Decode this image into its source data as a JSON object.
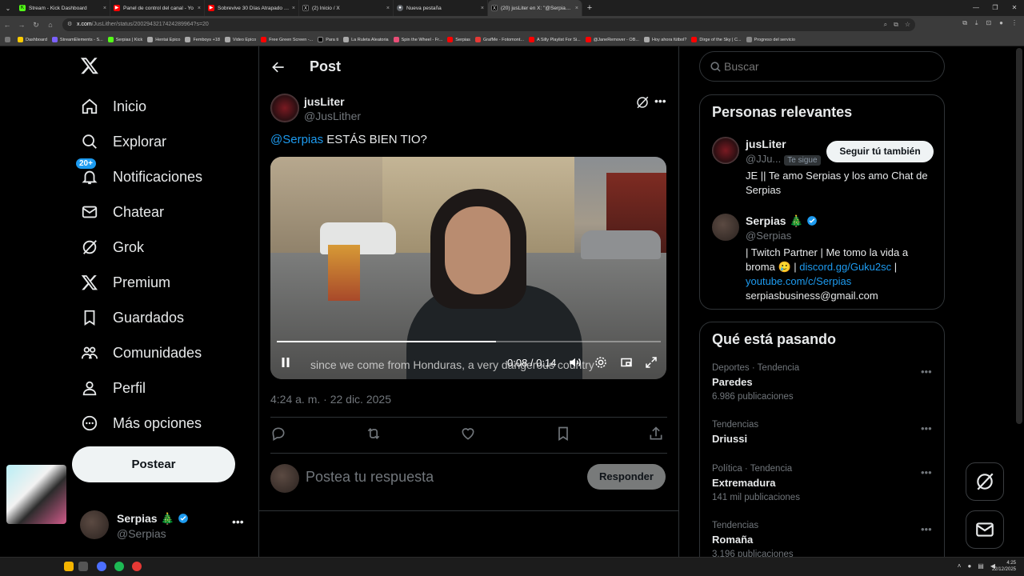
{
  "browser": {
    "tabs": [
      {
        "title": "Stream - Kick Dashboard",
        "color": "#53fc18"
      },
      {
        "title": "Panel de control del canal - Yo",
        "color": "#ff0000"
      },
      {
        "title": "Sobrevive 30 Días Atrapado En",
        "color": "#ff0000"
      },
      {
        "title": "(2) Inicio / X",
        "color": "#000000"
      },
      {
        "title": "Nueva pestaña",
        "color": "#5f6368"
      },
      {
        "title": "(20) jusLiter en X: \"@Serpias E",
        "color": "#000000"
      }
    ],
    "url_host": "x.com",
    "url_path": "/JusLither/status/2002943217424289964?s=20",
    "bookmarks": [
      "Dashboard",
      "StreamElements - S...",
      "Serpias | Kick",
      "Hentai Epico",
      "Femboys +18",
      "Video Epico",
      "Free Green Screen -...",
      "Para ti",
      "La Ruleta Aleatoria",
      "Spin the Wheel - Fr...",
      "Serpias",
      "GrafMe - Fotomont...",
      "A Silly Playlist For Si...",
      "@JaneRemover - OB...",
      "Hoy ahora fútbol?",
      "Dirge of the Sky | C...",
      "Progreso del servicio"
    ]
  },
  "nav": {
    "items": [
      {
        "label": "Inicio"
      },
      {
        "label": "Explorar"
      },
      {
        "label": "Notificaciones",
        "badge": "20+"
      },
      {
        "label": "Chatear"
      },
      {
        "label": "Grok"
      },
      {
        "label": "Premium"
      },
      {
        "label": "Guardados"
      },
      {
        "label": "Comunidades"
      },
      {
        "label": "Perfil"
      },
      {
        "label": "Más opciones"
      }
    ],
    "post_button": "Postear",
    "account": {
      "name": "Serpias 🎄",
      "handle": "@Serpias"
    }
  },
  "post": {
    "header_title": "Post",
    "author_name": "jusLiter",
    "author_handle": "@JusLither",
    "mention": "@Serpias",
    "text": " ESTÁS BIEN TIO?",
    "video": {
      "subtitle": "since we come from Honduras, a very dangerous country",
      "time": "0:08 / 0:14",
      "progress": 0.57
    },
    "timestamp": "4:24 a. m. · 22 dic. 2025",
    "reply_placeholder": "Postea tu respuesta",
    "reply_button": "Responder"
  },
  "sidebar": {
    "search_placeholder": "Buscar",
    "relevant": {
      "title": "Personas relevantes",
      "people": [
        {
          "name": "jusLiter",
          "handle": "@JJu...",
          "follows_you": "Te sigue",
          "follow_button": "Seguir tú también",
          "bio": "JE || Te amo Serpias y los amo Chat de Serpias"
        },
        {
          "name": "Serpias 🎄",
          "handle": "@Serpias",
          "bio_prefix": "| Twitch Partner | Me tomo la vida a broma 🥲 | ",
          "bio_link1": "discord.gg/Guku2sc",
          "bio_sep": " |",
          "bio_link2": "youtube.com/c/Serpias",
          "bio_email": "serpiasbusiness@gmail.com"
        }
      ]
    },
    "trends": {
      "title": "Qué está pasando",
      "items": [
        {
          "meta": "Deportes · Tendencia",
          "name": "Paredes",
          "count": "6.986 publicaciones"
        },
        {
          "meta": "Tendencias",
          "name": "Driussi",
          "count": ""
        },
        {
          "meta": "Política · Tendencia",
          "name": "Extremadura",
          "count": "141 mil publicaciones"
        },
        {
          "meta": "Tendencias",
          "name": "Romaña",
          "count": "3.196 publicaciones"
        }
      ]
    }
  },
  "taskbar": {
    "time": "4:25",
    "date": "22/12/2025"
  },
  "colors": {
    "accent": "#1d9bf0",
    "background": "#000000",
    "border": "#2f3336",
    "muted": "#71767b"
  }
}
